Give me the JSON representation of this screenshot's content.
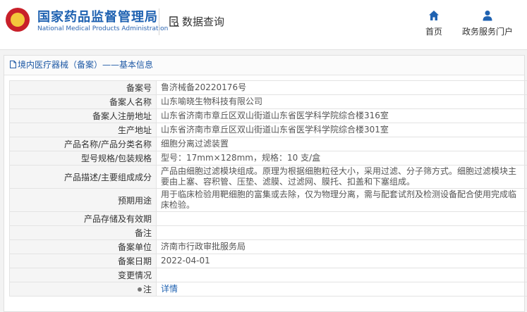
{
  "header": {
    "site_name": "国家药品监督管理局",
    "site_name_en": "National Medical Products Administration",
    "query_label": "数据查询",
    "nav": [
      {
        "label": "首页",
        "icon": "home-icon"
      },
      {
        "label": "政务服务门户",
        "icon": "user-icon"
      }
    ]
  },
  "panel": {
    "title": "境内医疗器械（备案）——基本信息"
  },
  "rows": [
    {
      "key": "备案号",
      "value": "鲁济械备20220176号"
    },
    {
      "key": "备案人名称",
      "value": "山东喻晓生物科技有限公司"
    },
    {
      "key": "备案人注册地址",
      "value": "山东省济南市章丘区双山街道山东省医学科学院综合楼316室"
    },
    {
      "key": "生产地址",
      "value": "山东省济南市章丘区双山街道山东省医学科学院综合楼301室"
    },
    {
      "key": "产品名称/产品分类名称",
      "value": "细胞分离过滤装置"
    },
    {
      "key": "型号规格/包装规格",
      "value": "型号：17mm×128mm，规格：10 支/盒"
    },
    {
      "key": "产品描述/主要组成成分",
      "value": "产品由细胞过滤模块组成。原理为根据细胞粒径大小，采用过滤、分子筛方式。细胞过滤模块主要由上塞、容积管、压垫、滤膜、过滤网、膜托、扣盖和下塞组成。"
    },
    {
      "key": "预期用途",
      "value": "用于临床检验用靶细胞的富集或去除，仅为物理分离，需与配套试剂及检测设备配合使用完成临床检验。"
    },
    {
      "key": "产品存储及有效期",
      "value": ""
    },
    {
      "key": "备注",
      "value": ""
    },
    {
      "key": "备案单位",
      "value": "济南市行政审批服务局"
    },
    {
      "key": "备案日期",
      "value": "2022-04-01"
    },
    {
      "key": "变更情况",
      "value": ""
    },
    {
      "key": "注",
      "value": "详情"
    }
  ],
  "colors": {
    "brand_blue": "#1f62b1",
    "logo_red": "#c8202a",
    "logo_gold": "#f3c63c"
  }
}
